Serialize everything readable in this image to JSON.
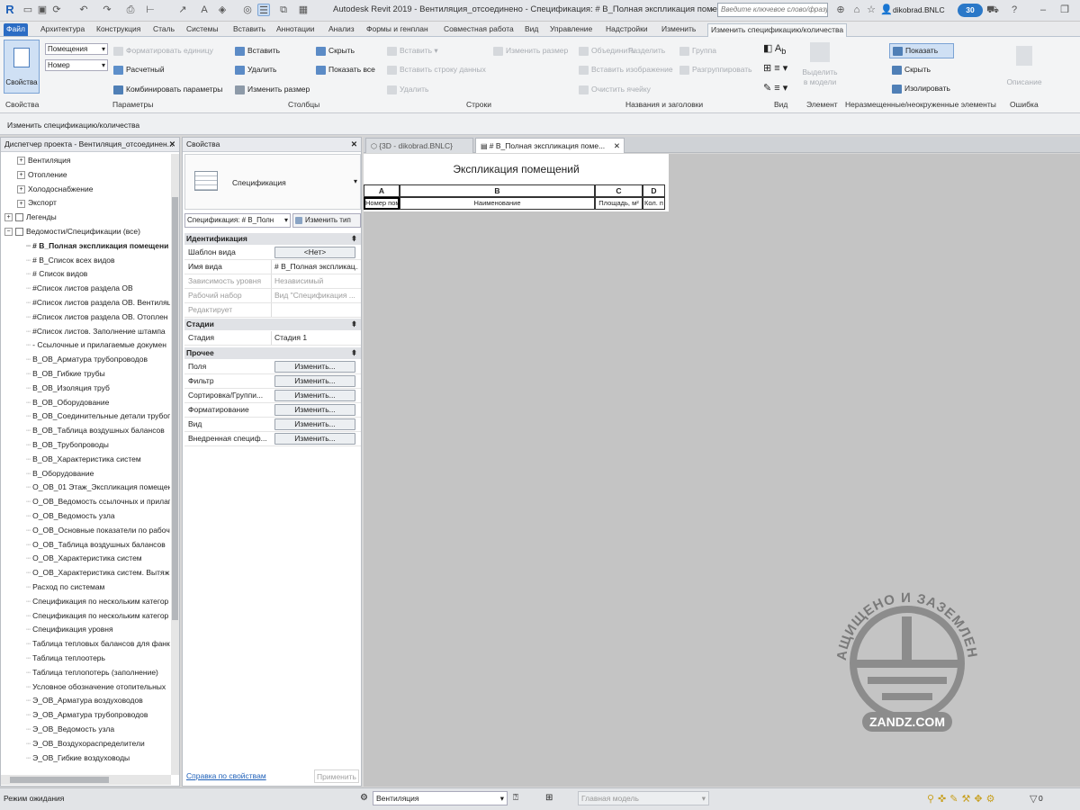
{
  "app": {
    "title": "Autodesk Revit 2019 - Вентиляция_отсоединено - Спецификация: # В_Полная экспликация помещений",
    "search_placeholder": "Введите ключевое слово/фразу",
    "user": "dikobrad.BNLC",
    "badge": "30"
  },
  "ribbon_tabs": [
    "Файл",
    "Архитектура",
    "Конструкция",
    "Сталь",
    "Системы",
    "Вставить",
    "Аннотации",
    "Анализ",
    "Формы и генплан",
    "Совместная работа",
    "Вид",
    "Управление",
    "Надстройки",
    "Изменить",
    "Изменить спецификацию/количества"
  ],
  "ribbon": {
    "properties_btn": "Свойства",
    "dd1": "Помещения",
    "dd2": "Номер",
    "params": {
      "format_unit": "Форматировать единицу",
      "calculated": "Расчетный",
      "combine": "Комбинировать параметры"
    },
    "cols": {
      "insert": "Вставить",
      "delete": "Удалить",
      "resize": "Изменить размер",
      "hide": "Скрыть",
      "show_all": "Показать все"
    },
    "rows": {
      "insert": "Вставить",
      "insert_data_row": "Вставить строку данных",
      "delete": "Удалить"
    },
    "titles": {
      "resize": "Изменить размер",
      "merge": "Объединить",
      "unmerge": "Разделить",
      "insert_image": "Вставить изображение",
      "clear_cell": "Очистить ячейку",
      "group": "Группа",
      "ungroup": "Разгруппировать"
    },
    "element": {
      "highlight": "Выделить в модели"
    },
    "unplaced": {
      "show": "Показать",
      "hide": "Скрыть",
      "isolate": "Изолировать"
    },
    "error": {
      "description": "Описание"
    },
    "panels": [
      "Свойства",
      "Параметры",
      "Столбцы",
      "Строки",
      "Названия и заголовки",
      "Вид",
      "Элемент",
      "Неразмещенные/неокруженные элементы",
      "Ошибка"
    ],
    "context_label": "Изменить спецификацию/количества"
  },
  "project_browser": {
    "title": "Диспетчер проекта - Вентиляция_отсоединен...",
    "items": [
      {
        "t": "Вентиляция",
        "lvl": 1,
        "exp": "+"
      },
      {
        "t": "Отопление",
        "lvl": 1,
        "exp": "+"
      },
      {
        "t": "Холодоснабжение",
        "lvl": 1,
        "exp": "+"
      },
      {
        "t": "Экспорт",
        "lvl": 1,
        "exp": "+"
      },
      {
        "t": "Легенды",
        "lvl": 0,
        "exp": "+"
      },
      {
        "t": "Ведомости/Спецификации (все)",
        "lvl": 0,
        "exp": "−"
      },
      {
        "t": "# В_Полная экспликация помещени",
        "lvl": 2,
        "bold": true
      },
      {
        "t": "# В_Список всех видов",
        "lvl": 2
      },
      {
        "t": "# Список видов",
        "lvl": 2
      },
      {
        "t": "#Список листов раздела ОВ",
        "lvl": 2
      },
      {
        "t": "#Список листов раздела ОВ. Вентиляц",
        "lvl": 2
      },
      {
        "t": "#Список листов раздела ОВ. Отоплен",
        "lvl": 2
      },
      {
        "t": "#Список листов. Заполнение штампа",
        "lvl": 2
      },
      {
        "t": "- Ссылочные и прилагаемые докумен",
        "lvl": 2
      },
      {
        "t": "В_ОВ_Арматура трубопроводов",
        "lvl": 2
      },
      {
        "t": "В_ОВ_Гибкие трубы",
        "lvl": 2
      },
      {
        "t": "В_ОВ_Изоляция труб",
        "lvl": 2
      },
      {
        "t": "В_ОВ_Оборудование",
        "lvl": 2
      },
      {
        "t": "В_ОВ_Соединительные детали трубопр",
        "lvl": 2
      },
      {
        "t": "В_ОВ_Таблица воздушных балансов",
        "lvl": 2
      },
      {
        "t": "В_ОВ_Трубопроводы",
        "lvl": 2
      },
      {
        "t": "В_ОВ_Характеристика систем",
        "lvl": 2
      },
      {
        "t": "В_Оборудование",
        "lvl": 2
      },
      {
        "t": "О_ОВ_01 Этаж_Экспликация помещени",
        "lvl": 2
      },
      {
        "t": "О_ОВ_Ведомость ссылочных и прилаг",
        "lvl": 2
      },
      {
        "t": "О_ОВ_Ведомость узла",
        "lvl": 2
      },
      {
        "t": "О_ОВ_Основные показатели по рабоч",
        "lvl": 2
      },
      {
        "t": "О_ОВ_Таблица воздушных балансов",
        "lvl": 2
      },
      {
        "t": "О_ОВ_Характеристика систем",
        "lvl": 2
      },
      {
        "t": "О_ОВ_Характеристика систем. Вытяж",
        "lvl": 2
      },
      {
        "t": "Расход по системам",
        "lvl": 2
      },
      {
        "t": "Спецификация по нескольким категор",
        "lvl": 2
      },
      {
        "t": "Спецификация по нескольким категор",
        "lvl": 2
      },
      {
        "t": "Спецификация уровня",
        "lvl": 2
      },
      {
        "t": "Таблица тепловых балансов для фанко",
        "lvl": 2
      },
      {
        "t": "Таблица теплоотерь",
        "lvl": 2
      },
      {
        "t": "Таблица теплопотерь (заполнение)",
        "lvl": 2
      },
      {
        "t": "Условное обозначение отопительных",
        "lvl": 2
      },
      {
        "t": "Э_ОВ_Арматура воздуховодов",
        "lvl": 2
      },
      {
        "t": "Э_ОВ_Арматура трубопроводов",
        "lvl": 2
      },
      {
        "t": "Э_ОВ_Ведомость узла",
        "lvl": 2
      },
      {
        "t": "Э_ОВ_Воздухораспределители",
        "lvl": 2
      },
      {
        "t": "Э_ОВ_Гибкие воздуховоды",
        "lvl": 2
      }
    ]
  },
  "properties": {
    "title": "Свойства",
    "type_name": "Спецификация",
    "selector": "Спецификация: # В_Полн",
    "edit_type": "Изменить тип",
    "sections": {
      "identity": "Идентификация",
      "phases": "Стадии",
      "other": "Прочее"
    },
    "identity_rows": [
      {
        "k": "Шаблон вида",
        "v": "<Нет>",
        "button": true
      },
      {
        "k": "Имя вида",
        "v": "# В_Полная экспликац..."
      },
      {
        "k": "Зависимость уровня",
        "v": "Независимый",
        "dis": true
      },
      {
        "k": "Рабочий набор",
        "v": "Вид \"Спецификация ...",
        "dis": true
      },
      {
        "k": "Редактирует",
        "v": "",
        "dis": true
      }
    ],
    "phase_rows": [
      {
        "k": "Стадия",
        "v": "Стадия 1"
      }
    ],
    "other_rows": [
      {
        "k": "Поля",
        "v": "Изменить..."
      },
      {
        "k": "Фильтр",
        "v": "Изменить..."
      },
      {
        "k": "Сортировка/Группи...",
        "v": "Изменить..."
      },
      {
        "k": "Форматирование",
        "v": "Изменить..."
      },
      {
        "k": "Вид",
        "v": "Изменить..."
      },
      {
        "k": "Внедренная специф...",
        "v": "Изменить..."
      }
    ],
    "help_link": "Справка по свойствам",
    "apply": "Применить"
  },
  "doc_tabs": [
    {
      "label": "{3D - dikobrad.BNLC}"
    },
    {
      "label": "# В_Полная экспликация поме..."
    }
  ],
  "schedule": {
    "title": "Экспликация помещений",
    "col_letters": [
      "A",
      "B",
      "C",
      "D"
    ],
    "col_headers": [
      "Номер пом",
      "Наименование",
      "Площадь, м²",
      "Кол. п"
    ]
  },
  "status": {
    "text": "Режим ожидания",
    "workset": "Вентиляция",
    "model": "Главная модель",
    "filter_count": "0"
  },
  "watermark": {
    "top_text": "ЗАЩИЩЕНО И ЗАЗЕМЛЕНО",
    "bottom_text": "ZANDZ.COM"
  }
}
